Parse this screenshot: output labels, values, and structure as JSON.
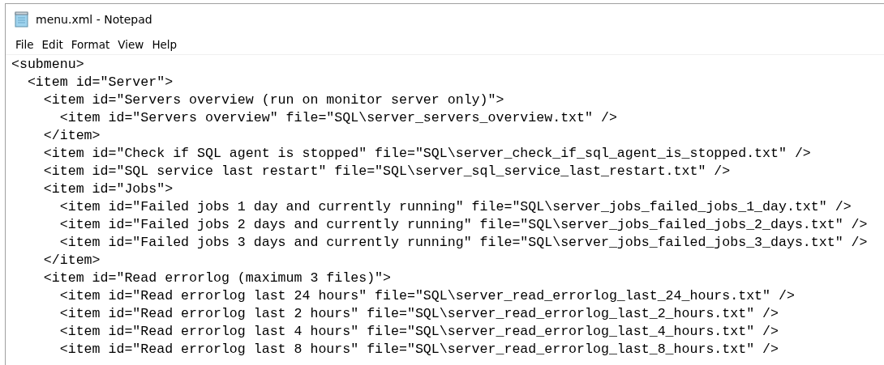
{
  "window": {
    "title": "menu.xml - Notepad"
  },
  "menu": [
    "File",
    "Edit",
    "Format",
    "View",
    "Help"
  ],
  "editor": {
    "lines": [
      "<submenu>",
      "  <item id=\"Server\">",
      "    <item id=\"Servers overview (run on monitor server only)\">",
      "      <item id=\"Servers overview\" file=\"SQL\\server_servers_overview.txt\" />",
      "    </item>",
      "    <item id=\"Check if SQL agent is stopped\" file=\"SQL\\server_check_if_sql_agent_is_stopped.txt\" />",
      "    <item id=\"SQL service last restart\" file=\"SQL\\server_sql_service_last_restart.txt\" />",
      "    <item id=\"Jobs\">",
      "      <item id=\"Failed jobs 1 day and currently running\" file=\"SQL\\server_jobs_failed_jobs_1_day.txt\" />",
      "      <item id=\"Failed jobs 2 days and currently running\" file=\"SQL\\server_jobs_failed_jobs_2_days.txt\" />",
      "      <item id=\"Failed jobs 3 days and currently running\" file=\"SQL\\server_jobs_failed_jobs_3_days.txt\" />",
      "    </item>",
      "    <item id=\"Read errorlog (maximum 3 files)\">",
      "      <item id=\"Read errorlog last 24 hours\" file=\"SQL\\server_read_errorlog_last_24_hours.txt\" />",
      "      <item id=\"Read errorlog last 2 hours\" file=\"SQL\\server_read_errorlog_last_2_hours.txt\" />",
      "      <item id=\"Read errorlog last 4 hours\" file=\"SQL\\server_read_errorlog_last_4_hours.txt\" />",
      "      <item id=\"Read errorlog last 8 hours\" file=\"SQL\\server_read_errorlog_last_8_hours.txt\" />"
    ]
  }
}
